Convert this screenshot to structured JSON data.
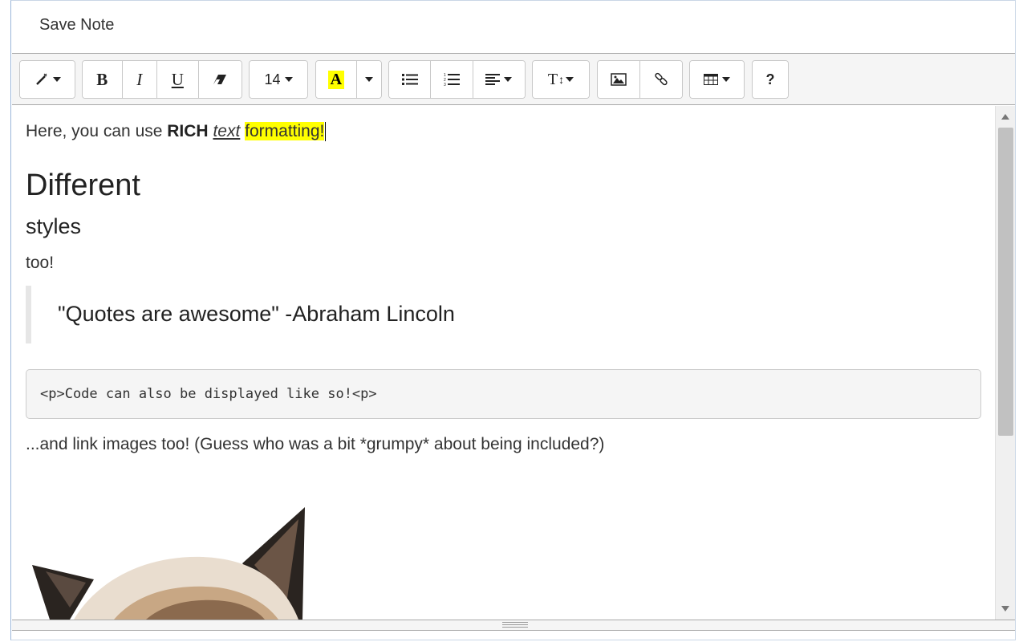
{
  "header": {
    "save_label": "Save Note"
  },
  "toolbar": {
    "style_icon": "magic-wand-icon",
    "bold": "B",
    "italic": "I",
    "underline": "U",
    "eraser_icon": "eraser-icon",
    "font_size": "14",
    "color_letter": "A",
    "color_highlight": "#ffff00",
    "ul_icon": "unordered-list-icon",
    "ol_icon": "ordered-list-icon",
    "align_icon": "align-icon",
    "line_height_label": "T",
    "image_icon": "image-icon",
    "link_icon": "link-icon",
    "table_icon": "table-icon",
    "help_label": "?"
  },
  "content": {
    "p1_prefix": "Here, you can use ",
    "p1_bold": "RICH",
    "p1_space": " ",
    "p1_italic": "text",
    "p1_highlight": "formatting!",
    "heading1": "Different",
    "heading2": "styles",
    "too": "too!",
    "quote": "\"Quotes are awesome\" -Abraham Lincoln",
    "code": "<p>Code can also be displayed like so!<p>",
    "link_text": "...and link images too! (Guess who was a bit *grumpy* about being included?)"
  }
}
